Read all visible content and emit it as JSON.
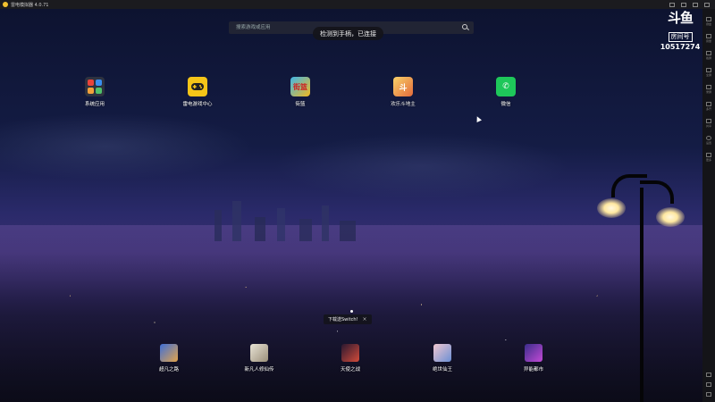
{
  "titlebar": {
    "title": "雷电模拟器 4.0.71"
  },
  "search": {
    "placeholder": "搜索游戏或应用"
  },
  "toast": {
    "text": "检测到手柄，已连接"
  },
  "watermark": {
    "logo": "斗鱼",
    "badge": "房间号",
    "room_number": "10517274"
  },
  "desktop_apps": [
    {
      "label": "系统应用",
      "icon": "folder-icon"
    },
    {
      "label": "雷电游戏中心",
      "icon": "gamepad-icon"
    },
    {
      "label": "街篮",
      "icon": "jietou-icon",
      "glyph": "街篮"
    },
    {
      "label": "欢乐斗地主",
      "icon": "doudizhu-icon",
      "glyph": "斗"
    },
    {
      "label": "微信",
      "icon": "wechat-icon",
      "glyph": "✆"
    }
  ],
  "dock_apps": [
    {
      "label": "超凡之路",
      "icon": "game-icon"
    },
    {
      "label": "新凡人修仙传",
      "icon": "game-icon"
    },
    {
      "label": "天使之战",
      "icon": "game-icon"
    },
    {
      "label": "绝世仙王",
      "icon": "game-icon"
    },
    {
      "label": "异能都市",
      "icon": "game-icon"
    }
  ],
  "notification": {
    "text": "下载送Switch!",
    "close": "×"
  },
  "sidebar": {
    "items": [
      "键盘",
      "音量",
      "截屏",
      "全屏",
      "录屏",
      "多开",
      "共享",
      "设置",
      "更多"
    ]
  },
  "colors": {
    "wechat": "#1ec75a",
    "gamepad": "#f5c518"
  }
}
